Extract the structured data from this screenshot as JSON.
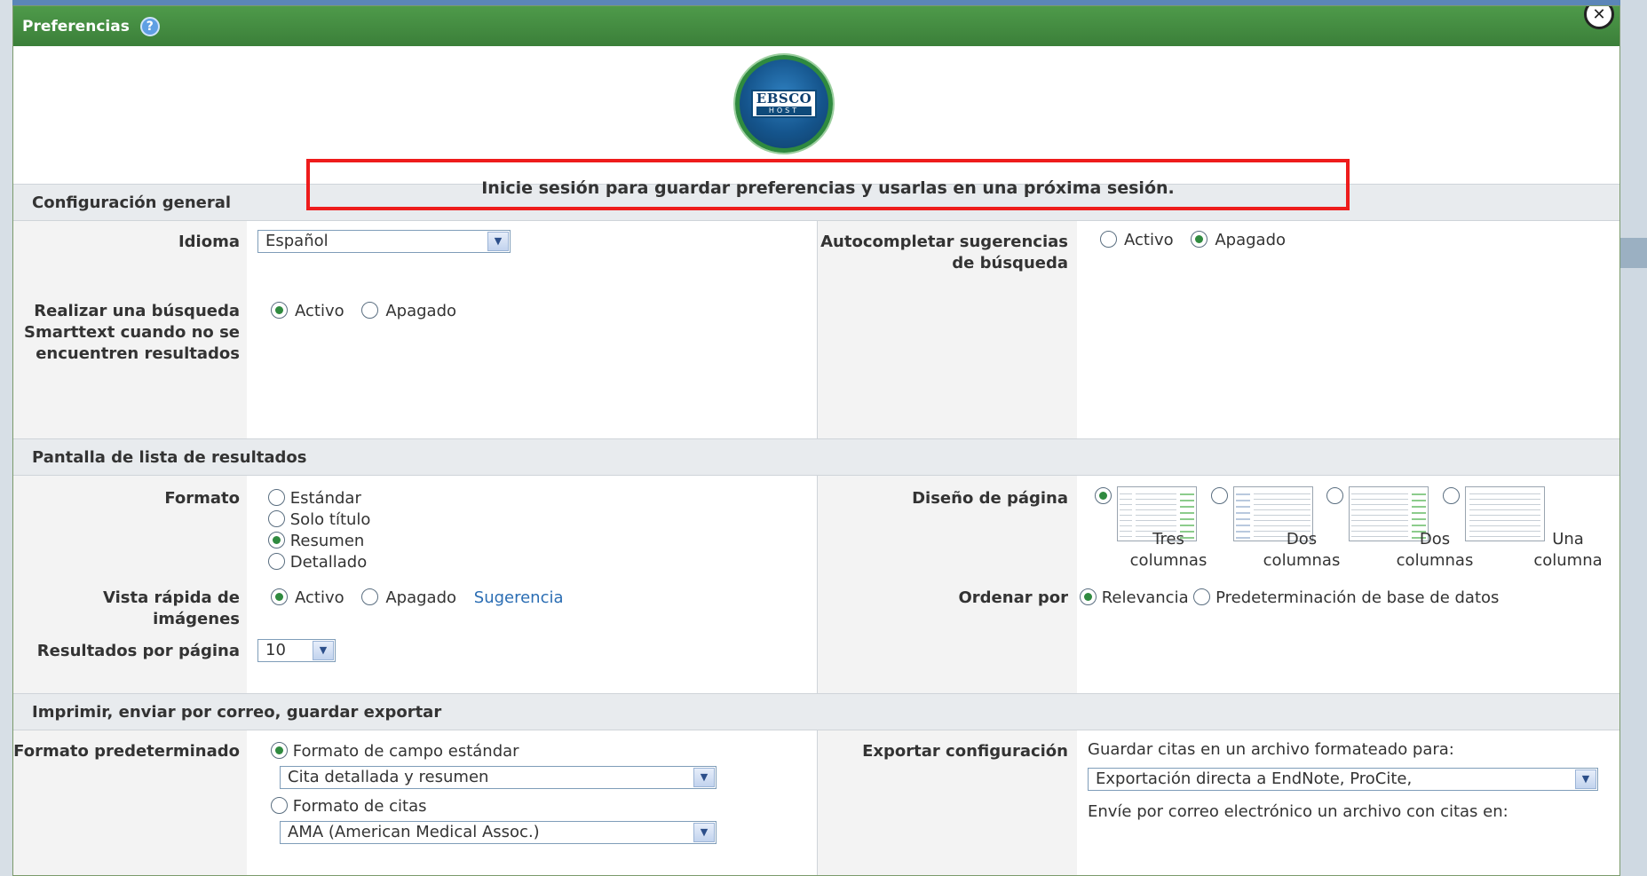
{
  "dialog": {
    "title": "Preferencias",
    "help_glyph": "?",
    "close_glyph": "✕",
    "notice": "Inicie sesión para guardar preferencias y usarlas en una próxima sesión.",
    "logo": {
      "top": "EBSCO",
      "bottom": "HOST"
    }
  },
  "general": {
    "header": "Configuración general",
    "idioma": {
      "label": "Idioma",
      "value": "Español"
    },
    "autocompletar": {
      "label": "Autocompletar sugerencias de búsqueda",
      "options": [
        "Activo",
        "Apagado"
      ],
      "selected": 1
    },
    "smarttext": {
      "label": "Realizar una búsqueda Smarttext cuando no se encuentren resultados",
      "options": [
        "Activo",
        "Apagado"
      ],
      "selected": 0
    }
  },
  "results": {
    "header": "Pantalla de lista de resultados",
    "formato": {
      "label": "Formato",
      "options": [
        "Estándar",
        "Solo título",
        "Resumen",
        "Detallado"
      ],
      "selected": 2
    },
    "diseno": {
      "label": "Diseño de página",
      "options": [
        "Tres columnas",
        "Dos columnas",
        "Dos columnas",
        "Una columna"
      ],
      "selected": 0
    },
    "vista_rapida": {
      "label": "Vista rápida de imágenes",
      "options": [
        "Activo",
        "Apagado"
      ],
      "selected": 0,
      "link": "Sugerencia"
    },
    "ordenar": {
      "label": "Ordenar por",
      "options": [
        "Relevancia",
        "Predeterminación de base de datos"
      ],
      "selected": 0
    },
    "por_pagina": {
      "label": "Resultados por página",
      "value": "10"
    }
  },
  "export": {
    "header": "Imprimir, enviar por correo, guardar exportar",
    "formato_pred": {
      "label": "Formato predeterminado",
      "opt1": "Formato de campo estándar",
      "opt1_select": "Cita detallada y resumen",
      "opt2": "Formato de citas",
      "opt2_select": "AMA (American Medical Assoc.)",
      "selected": 0
    },
    "exportar": {
      "label": "Exportar configuración",
      "save_text": "Guardar citas en un archivo formateado para:",
      "save_select": "Exportación directa a EndNote, ProCite,",
      "email_text": "Envíe por correo electrónico un archivo con citas en:"
    }
  },
  "colors": {
    "title_green": "#3b7f39",
    "radio_green": "#2f8a3f",
    "notice_border": "#ee1c1c",
    "link_blue": "#2a6db3"
  }
}
